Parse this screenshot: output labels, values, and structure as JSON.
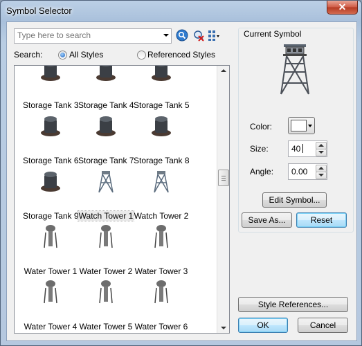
{
  "window": {
    "title": "Symbol Selector",
    "close_label": "✕"
  },
  "search": {
    "placeholder": "Type here to search",
    "label": "Search:"
  },
  "scope": {
    "all_styles": "All Styles",
    "referenced_styles": "Referenced Styles",
    "selected": "All Styles"
  },
  "icons": {
    "search": "search-icon",
    "clear": "clear-search-icon",
    "view": "list-view-icon",
    "scroll_up": "scroll-up-arrow-icon",
    "scroll_down": "scroll-down-arrow-icon"
  },
  "symbols": [
    {
      "label": "Storage Tank 3"
    },
    {
      "label": "Storage Tank 4"
    },
    {
      "label": "Storage Tank 5"
    },
    {
      "label": "Storage Tank 6"
    },
    {
      "label": "Storage Tank 7"
    },
    {
      "label": "Storage Tank 8"
    },
    {
      "label": "Storage Tank 9"
    },
    {
      "label": "Watch Tower 1"
    },
    {
      "label": "Watch Tower 2"
    },
    {
      "label": "Water Tower 1"
    },
    {
      "label": "Water Tower 2"
    },
    {
      "label": "Water Tower 3"
    },
    {
      "label": "Water Tower 4"
    },
    {
      "label": "Water Tower 5"
    },
    {
      "label": "Water Tower 6"
    }
  ],
  "selected_symbol": "Watch Tower 1",
  "current_symbol": {
    "title": "Current Symbol",
    "color_label": "Color:",
    "color_value": "#ffffff",
    "size_label": "Size:",
    "size_value": "40",
    "angle_label": "Angle:",
    "angle_value": "0.00"
  },
  "buttons": {
    "edit_symbol": "Edit Symbol...",
    "save_as": "Save As...",
    "reset": "Reset",
    "style_references": "Style References...",
    "ok": "OK",
    "cancel": "Cancel"
  }
}
